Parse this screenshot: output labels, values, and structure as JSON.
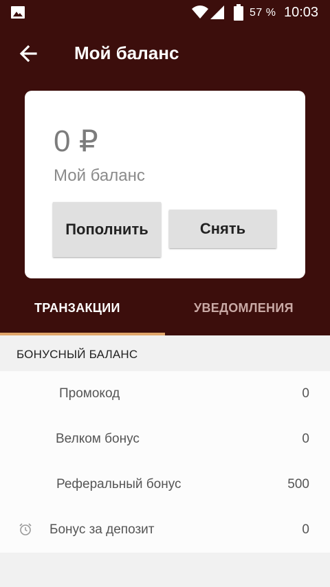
{
  "status_bar": {
    "battery": "57 %",
    "time": "10:03"
  },
  "toolbar": {
    "title": "Мой баланс"
  },
  "balance_card": {
    "amount": "0 ₽",
    "label": "Мой баланс",
    "topup_button": "Пополнить",
    "withdraw_button": "Снять"
  },
  "tabs": [
    {
      "label": "ТРАНЗАКЦИИ",
      "active": true
    },
    {
      "label": "УВЕДОМЛЕНИЯ",
      "active": false
    }
  ],
  "colors": {
    "header_background": "#3c0e0c",
    "tab_indicator": "#e0a56a"
  },
  "bonus": {
    "header": "БОНУСНЫЙ БАЛАНС",
    "items": [
      {
        "name": "Промокод",
        "value": "0"
      },
      {
        "name": "Велком бонус",
        "value": "0"
      },
      {
        "name": "Реферальный бонус",
        "value": "500"
      },
      {
        "name": "Бонус за депозит",
        "value": "0",
        "icon": "alarm-clock-icon"
      }
    ]
  }
}
